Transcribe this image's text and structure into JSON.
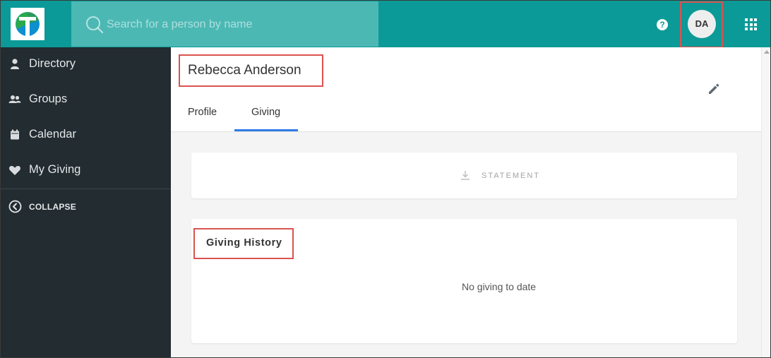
{
  "search": {
    "placeholder": "Search for a person by name"
  },
  "topbar": {
    "help_label": "?",
    "user_initials": "DA",
    "brand_color": "#0b9a98"
  },
  "sidebar": {
    "items": [
      {
        "label": "Directory",
        "icon": "person-icon"
      },
      {
        "label": "Groups",
        "icon": "people-icon"
      },
      {
        "label": "Calendar",
        "icon": "calendar-icon"
      },
      {
        "label": "My Giving",
        "icon": "heart-icon"
      }
    ],
    "collapse_label": "COLLAPSE"
  },
  "profile": {
    "name": "Rebecca Anderson",
    "tabs": [
      {
        "label": "Profile",
        "active": false
      },
      {
        "label": "Giving",
        "active": true
      }
    ]
  },
  "statement": {
    "label": "STATEMENT"
  },
  "giving_history": {
    "title": "Giving History",
    "empty_message": "No giving to date"
  },
  "colors": {
    "accent_tab": "#2f7be8",
    "highlight_box": "#d9534f",
    "sidebar_bg": "#222c31"
  }
}
